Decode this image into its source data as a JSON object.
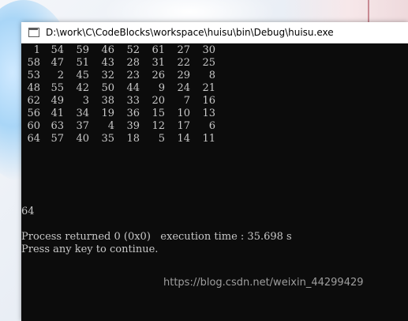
{
  "window": {
    "title": "D:\\work\\C\\CodeBlocks\\workspace\\huisu\\bin\\Debug\\huisu.exe",
    "icon": "console-window-icon"
  },
  "console": {
    "grid": [
      [
        "1",
        "54",
        "59",
        "46",
        "52",
        "61",
        "27",
        "30"
      ],
      [
        "58",
        "47",
        "51",
        "43",
        "28",
        "31",
        "22",
        "25"
      ],
      [
        "53",
        "2",
        "45",
        "32",
        "23",
        "26",
        "29",
        "8"
      ],
      [
        "48",
        "55",
        "42",
        "50",
        "44",
        "9",
        "24",
        "21"
      ],
      [
        "62",
        "49",
        "3",
        "38",
        "33",
        "20",
        "7",
        "16"
      ],
      [
        "56",
        "41",
        "34",
        "19",
        "36",
        "15",
        "10",
        "13"
      ],
      [
        "60",
        "63",
        "37",
        "4",
        "39",
        "12",
        "17",
        "6"
      ],
      [
        "64",
        "57",
        "40",
        "35",
        "18",
        "5",
        "14",
        "11"
      ]
    ],
    "count": "64",
    "process_line": "Process returned 0 (0x0)   execution time : 35.698 s",
    "continue_line": "Press any key to continue."
  },
  "watermark": "https://blog.csdn.net/weixin_44299429",
  "colors": {
    "console_bg": "#0c0c0c",
    "console_text": "#c8c8c8",
    "titlebar_bg": "#ffffff"
  }
}
